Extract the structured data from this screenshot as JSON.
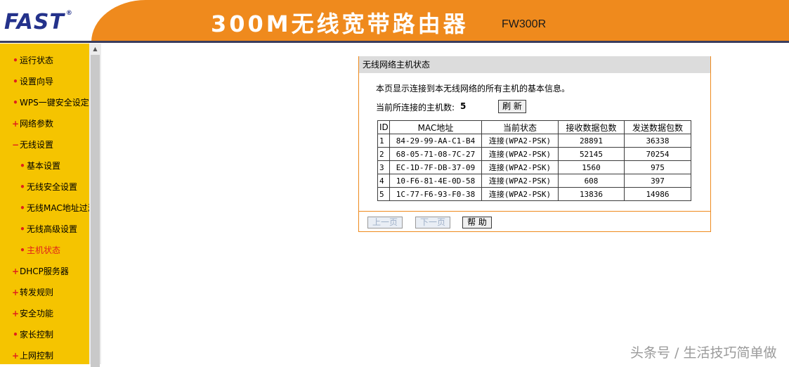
{
  "header": {
    "logo_text": "FAST",
    "logo_reg": "®",
    "product_title": "300M无线宽带路由器",
    "model": "FW300R",
    "accent_color": "#ef8a1d"
  },
  "sidebar": {
    "items": [
      {
        "label": "运行状态",
        "marker": "•"
      },
      {
        "label": "设置向导",
        "marker": "•"
      },
      {
        "label": "WPS一键安全设定",
        "marker": "•"
      },
      {
        "label": "网络参数",
        "marker": "+"
      },
      {
        "label": "无线设置",
        "marker": "−"
      },
      {
        "label": "基本设置",
        "marker": "•"
      },
      {
        "label": "无线安全设置",
        "marker": "•"
      },
      {
        "label": "无线MAC地址过滤",
        "marker": "•"
      },
      {
        "label": "无线高级设置",
        "marker": "•"
      },
      {
        "label": "主机状态",
        "marker": "•"
      },
      {
        "label": "DHCP服务器",
        "marker": "+"
      },
      {
        "label": "转发规则",
        "marker": "+"
      },
      {
        "label": "安全功能",
        "marker": "+"
      },
      {
        "label": "家长控制",
        "marker": "•"
      },
      {
        "label": "上网控制",
        "marker": "+"
      }
    ]
  },
  "panel": {
    "title": "无线网络主机状态",
    "description": "本页显示连接到本无线网络的所有主机的基本信息。",
    "count_label": "当前所连接的主机数:",
    "count_value": "5",
    "refresh_label": "刷 新",
    "table": {
      "headers": [
        "ID",
        "MAC地址",
        "当前状态",
        "接收数据包数",
        "发送数据包数"
      ],
      "rows": [
        [
          "1",
          "84-29-99-AA-C1-B4",
          "连接(WPA2-PSK)",
          "28891",
          "36338"
        ],
        [
          "2",
          "68-05-71-08-7C-27",
          "连接(WPA2-PSK)",
          "52145",
          "70254"
        ],
        [
          "3",
          "EC-1D-7F-DB-37-09",
          "连接(WPA2-PSK)",
          "1560",
          "975"
        ],
        [
          "4",
          "10-F6-81-4E-0D-58",
          "连接(WPA2-PSK)",
          "608",
          "397"
        ],
        [
          "5",
          "1C-77-F6-93-F0-38",
          "连接(WPA2-PSK)",
          "13836",
          "14986"
        ]
      ]
    },
    "prev_label": "上一页",
    "next_label": "下一页",
    "help_label": "帮 助"
  },
  "watermark": "头条号 / 生活技巧简单做"
}
